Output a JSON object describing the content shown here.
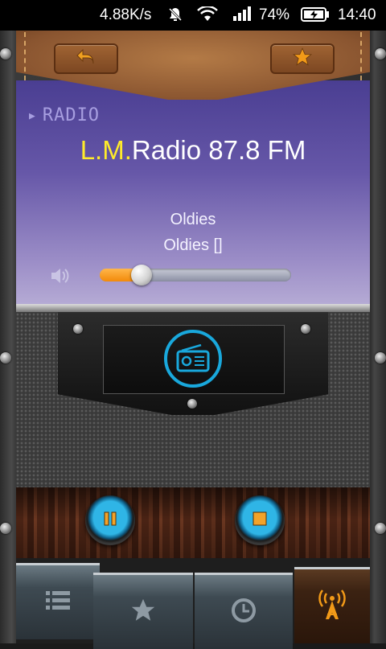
{
  "statusbar": {
    "net_speed": "4.88K/s",
    "battery_pct": "74%",
    "time": "14:40",
    "icons": [
      "alarm-off-icon",
      "wifi-icon",
      "signal-icon",
      "battery-charging-icon"
    ]
  },
  "header": {
    "back_icon": "back-arrow-icon",
    "favorite_icon": "star-icon"
  },
  "player": {
    "section_label": "RADIO",
    "station_prefix": "L.M.",
    "station_name": "Radio 87.8 FM",
    "genre": "Oldies",
    "now_playing": "Oldies []",
    "volume_level": 0.22
  },
  "controls": {
    "pause_icon": "pause-icon",
    "stop_icon": "stop-icon"
  },
  "nav": {
    "tabs": [
      {
        "icon": "list-icon",
        "active": false
      },
      {
        "icon": "star-icon",
        "active": false
      },
      {
        "icon": "clock-icon",
        "active": false
      },
      {
        "icon": "radio-tower-icon",
        "active": true
      }
    ]
  },
  "colors": {
    "accent_blue": "#19a8dc",
    "accent_orange": "#f28a0a",
    "station_prefix": "#ffeb2a",
    "panel_purple": "#5a4ca0"
  }
}
